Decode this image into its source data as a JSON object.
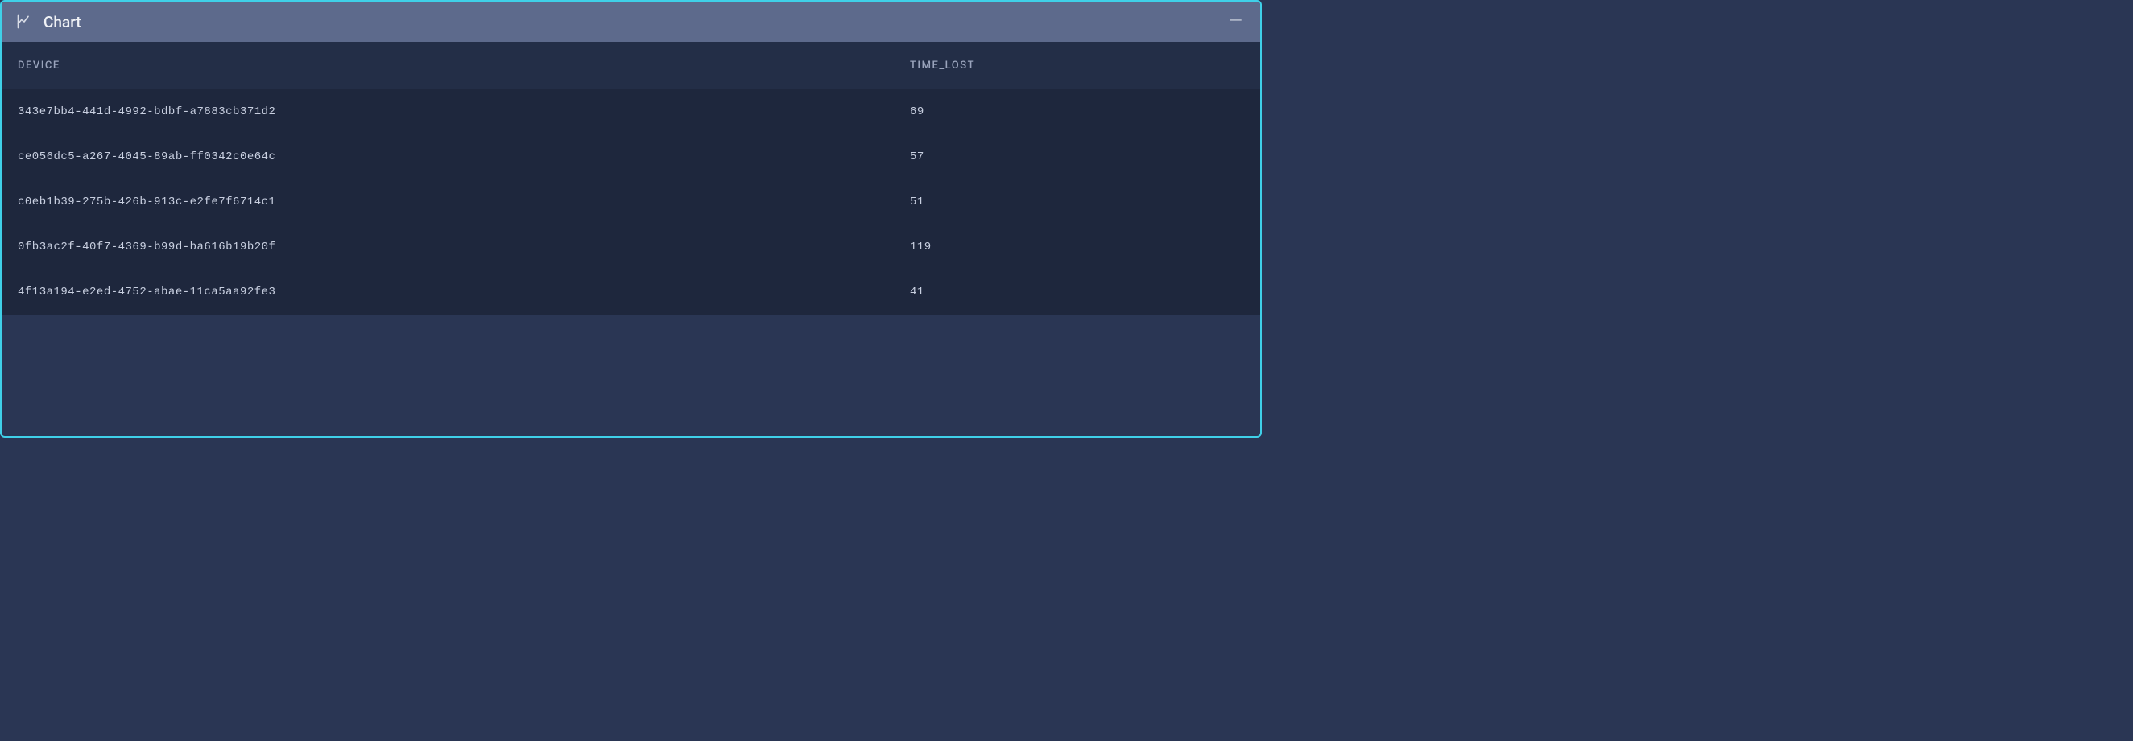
{
  "panel": {
    "title": "Chart"
  },
  "table": {
    "headers": {
      "device": "DEVICE",
      "time_lost": "TIME_LOST"
    },
    "rows": [
      {
        "device": "343e7bb4-441d-4992-bdbf-a7883cb371d2",
        "time_lost": "69"
      },
      {
        "device": "ce056dc5-a267-4045-89ab-ff0342c0e64c",
        "time_lost": "57"
      },
      {
        "device": "c0eb1b39-275b-426b-913c-e2fe7f6714c1",
        "time_lost": "51"
      },
      {
        "device": "0fb3ac2f-40f7-4369-b99d-ba616b19b20f",
        "time_lost": "119"
      },
      {
        "device": "4f13a194-e2ed-4752-abae-11ca5aa92fe3",
        "time_lost": "41"
      }
    ]
  },
  "chart_data": {
    "type": "table",
    "columns": [
      "DEVICE",
      "TIME_LOST"
    ],
    "rows": [
      [
        "343e7bb4-441d-4992-bdbf-a7883cb371d2",
        69
      ],
      [
        "ce056dc5-a267-4045-89ab-ff0342c0e64c",
        57
      ],
      [
        "c0eb1b39-275b-426b-913c-e2fe7f6714c1",
        51
      ],
      [
        "0fb3ac2f-40f7-4369-b99d-ba616b19b20f",
        119
      ],
      [
        "4f13a194-e2ed-4752-abae-11ca5aa92fe3",
        41
      ]
    ]
  }
}
